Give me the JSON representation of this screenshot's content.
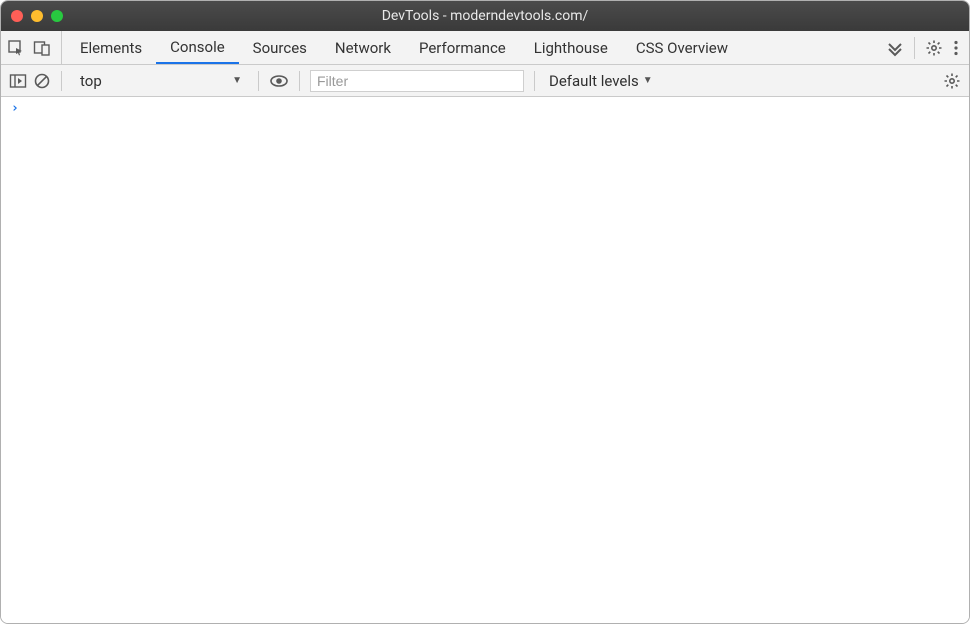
{
  "window": {
    "title": "DevTools - moderndevtools.com/"
  },
  "tabs": {
    "items": [
      {
        "label": "Elements",
        "active": false
      },
      {
        "label": "Console",
        "active": true
      },
      {
        "label": "Sources",
        "active": false
      },
      {
        "label": "Network",
        "active": false
      },
      {
        "label": "Performance",
        "active": false
      },
      {
        "label": "Lighthouse",
        "active": false
      },
      {
        "label": "CSS Overview",
        "active": false
      }
    ]
  },
  "toolbar": {
    "context": "top",
    "filter_placeholder": "Filter",
    "levels_label": "Default levels"
  },
  "console": {
    "prompt": "›"
  }
}
